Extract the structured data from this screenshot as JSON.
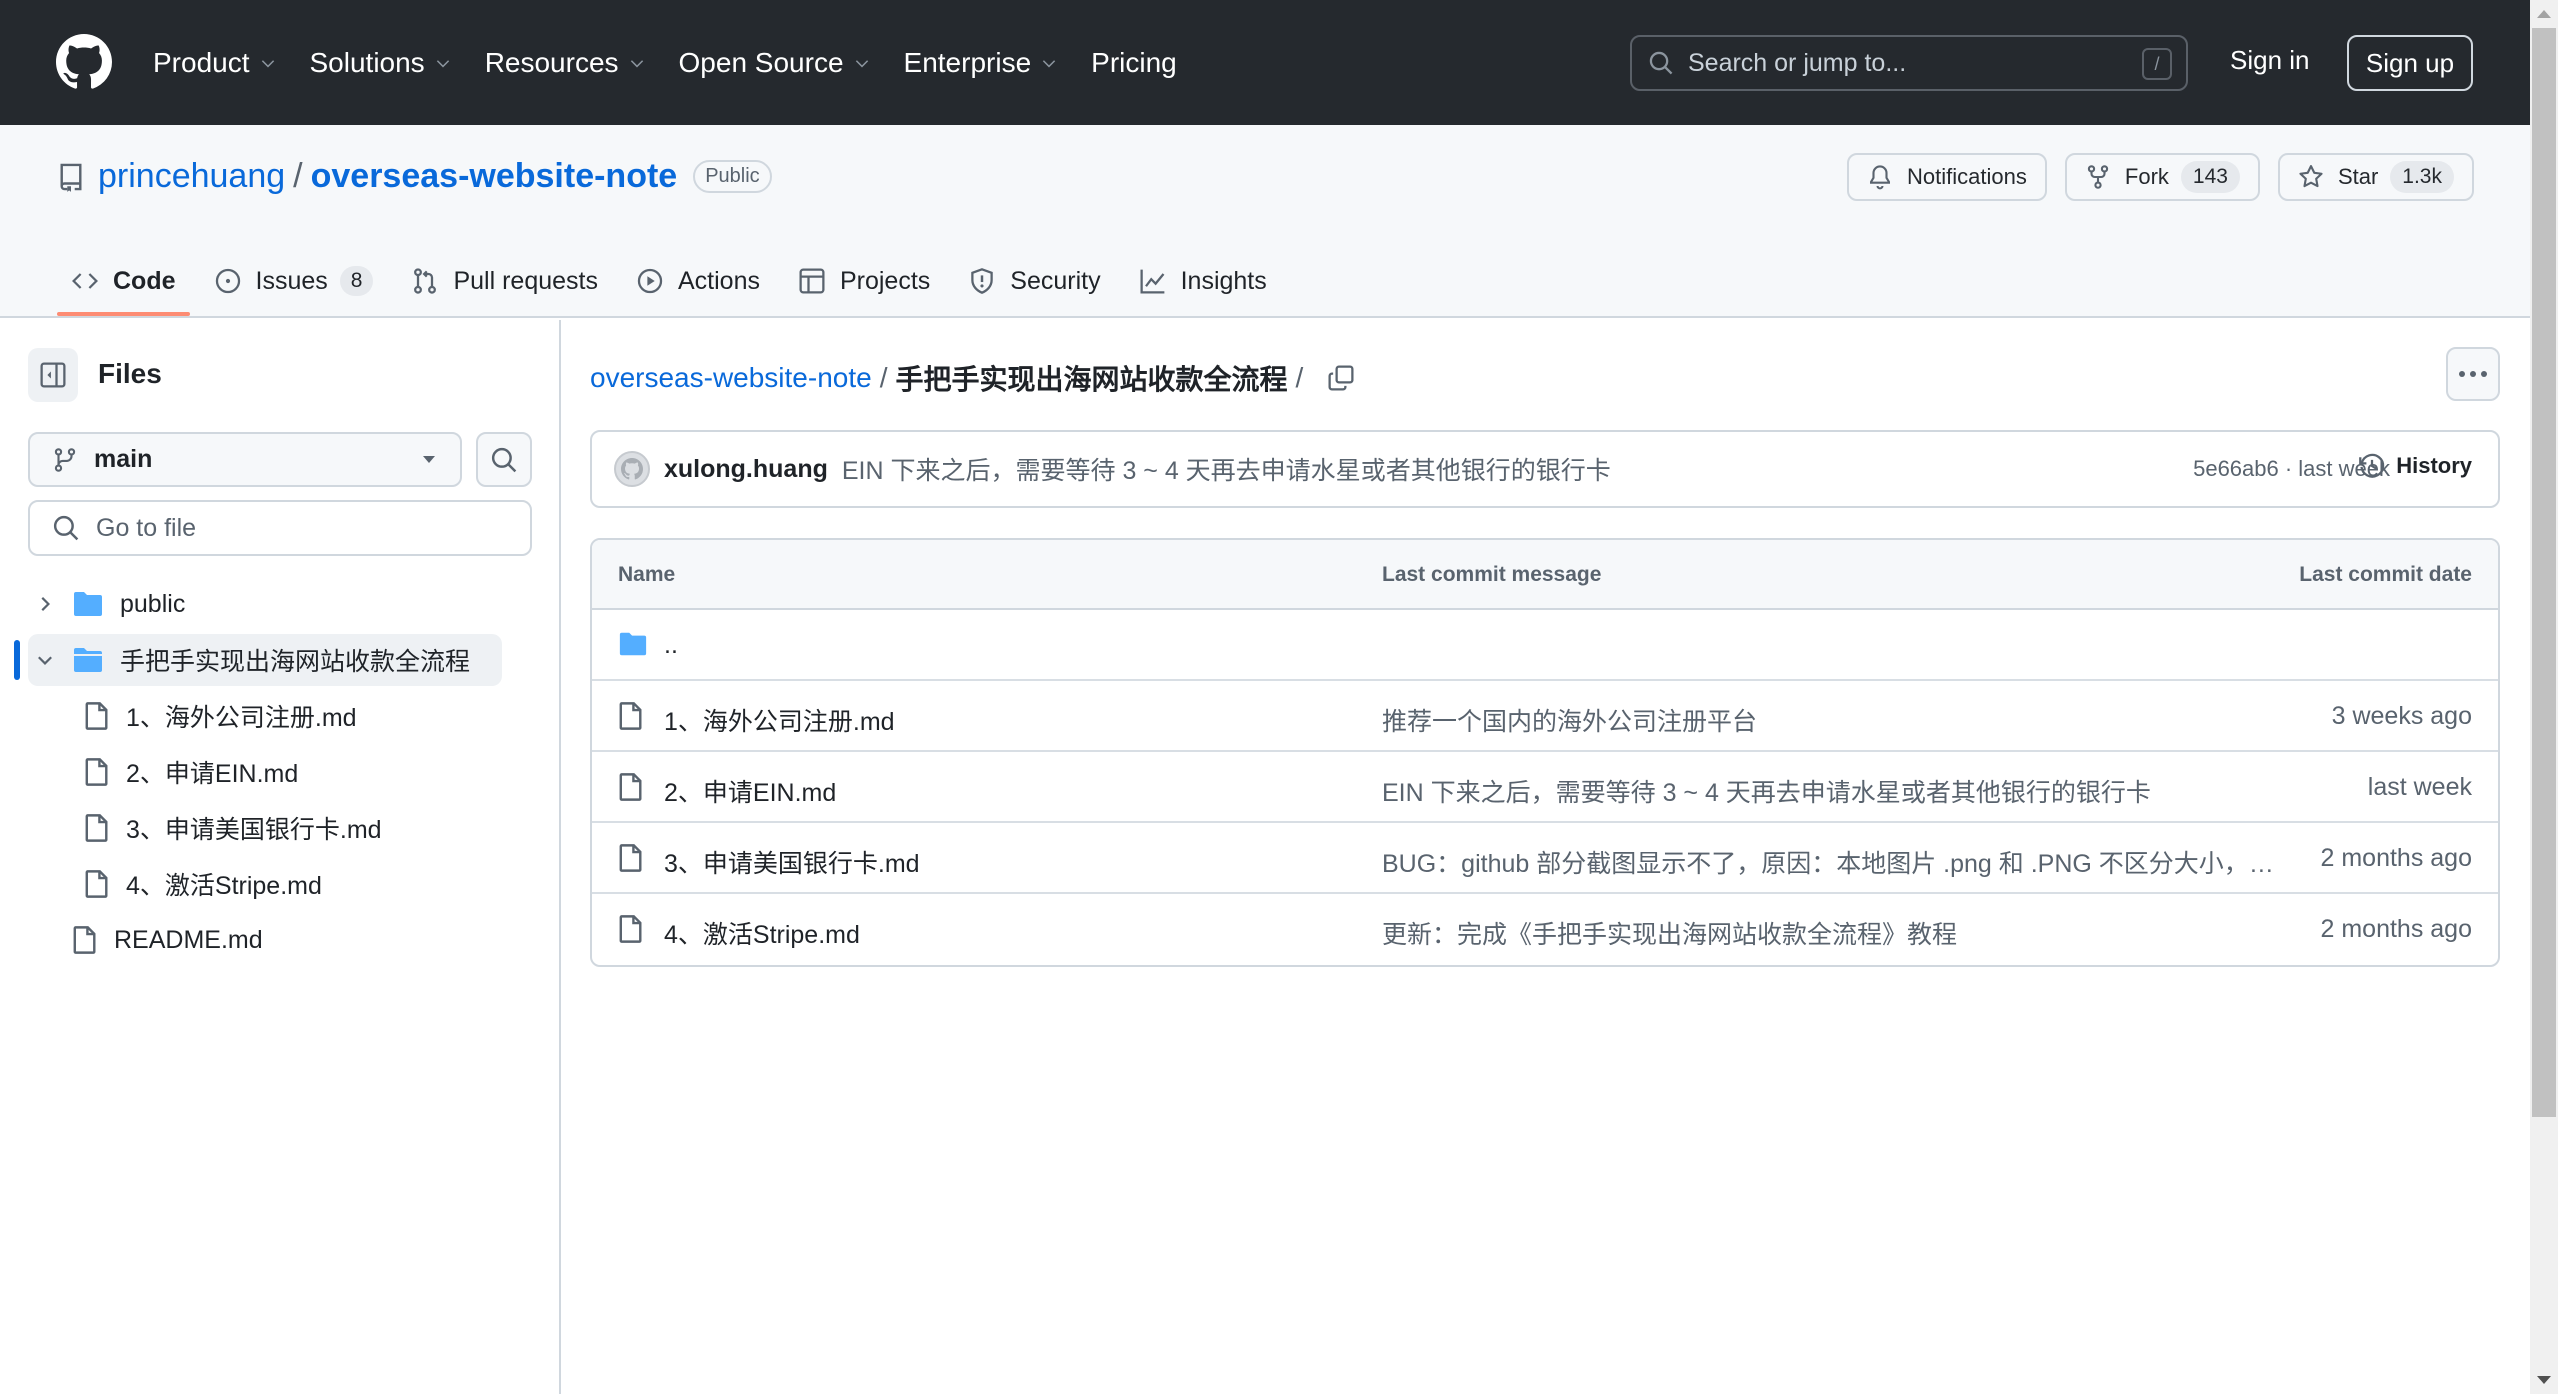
{
  "header": {
    "nav": [
      {
        "label": "Product",
        "has_dropdown": true
      },
      {
        "label": "Solutions",
        "has_dropdown": true
      },
      {
        "label": "Resources",
        "has_dropdown": true
      },
      {
        "label": "Open Source",
        "has_dropdown": true
      },
      {
        "label": "Enterprise",
        "has_dropdown": true
      },
      {
        "label": "Pricing",
        "has_dropdown": false
      }
    ],
    "search_placeholder": "Search or jump to...",
    "search_shortcut": "/",
    "sign_in": "Sign in",
    "sign_up": "Sign up"
  },
  "repo": {
    "owner": "princehuang",
    "separator": "/",
    "name": "overseas-website-note",
    "visibility": "Public",
    "actions": {
      "notifications": "Notifications",
      "fork": "Fork",
      "fork_count": "143",
      "star": "Star",
      "star_count": "1.3k"
    },
    "tabs": [
      {
        "label": "Code",
        "icon": "code-icon",
        "active": true
      },
      {
        "label": "Issues",
        "icon": "issue-icon",
        "count": "8"
      },
      {
        "label": "Pull requests",
        "icon": "pull-request-icon"
      },
      {
        "label": "Actions",
        "icon": "play-icon"
      },
      {
        "label": "Projects",
        "icon": "table-icon"
      },
      {
        "label": "Security",
        "icon": "shield-icon"
      },
      {
        "label": "Insights",
        "icon": "graph-icon"
      }
    ]
  },
  "sidebar": {
    "title": "Files",
    "branch": "main",
    "goto_placeholder": "Go to file",
    "tree": [
      {
        "label": "public",
        "type": "folder",
        "expanded": false,
        "depth": 0
      },
      {
        "label": "手把手实现出海网站收款全流程",
        "type": "folder",
        "expanded": true,
        "selected": true,
        "depth": 0
      },
      {
        "label": "1、海外公司注册.md",
        "type": "file",
        "depth": 1
      },
      {
        "label": "2、申请EIN.md",
        "type": "file",
        "depth": 1
      },
      {
        "label": "3、申请美国银行卡.md",
        "type": "file",
        "depth": 1
      },
      {
        "label": "4、激活Stripe.md",
        "type": "file",
        "depth": 1
      },
      {
        "label": "README.md",
        "type": "file",
        "depth": 0
      }
    ]
  },
  "main": {
    "breadcrumb": {
      "root": "overseas-website-note",
      "separator": "/",
      "current": "手把手实现出海网站收款全流程",
      "trailing": "/"
    },
    "latest_commit": {
      "author": "xulong.huang",
      "message": "EIN 下来之后，需要等待 3 ~ 4 天再去申请水星或者其他银行的银行卡",
      "meta": "5e66ab6 · last week",
      "history_label": "History"
    },
    "table": {
      "columns": [
        "Name",
        "Last commit message",
        "Last commit date"
      ],
      "parent_dir": "..",
      "rows": [
        {
          "name": "1、海外公司注册.md",
          "message": "推荐一个国内的海外公司注册平台",
          "date": "3 weeks ago"
        },
        {
          "name": "2、申请EIN.md",
          "message": "EIN 下来之后，需要等待 3 ~ 4 天再去申请水星或者其他银行的银行卡",
          "date": "last week"
        },
        {
          "name": "3、申请美国银行卡.md",
          "message": "BUG：github 部分截图显示不了，原因：本地图片 .png 和 .PNG 不区分大小，gi...",
          "date": "2 months ago"
        },
        {
          "name": "4、激活Stripe.md",
          "message": "更新：完成《手把手实现出海网站收款全流程》教程",
          "date": "2 months ago"
        }
      ]
    }
  },
  "colors": {
    "header_bg": "#25292e",
    "link": "#0969da",
    "tab_underline": "#fd8c73",
    "folder": "#54aeff",
    "muted_text": "#59636e",
    "border": "#d0d7de"
  }
}
